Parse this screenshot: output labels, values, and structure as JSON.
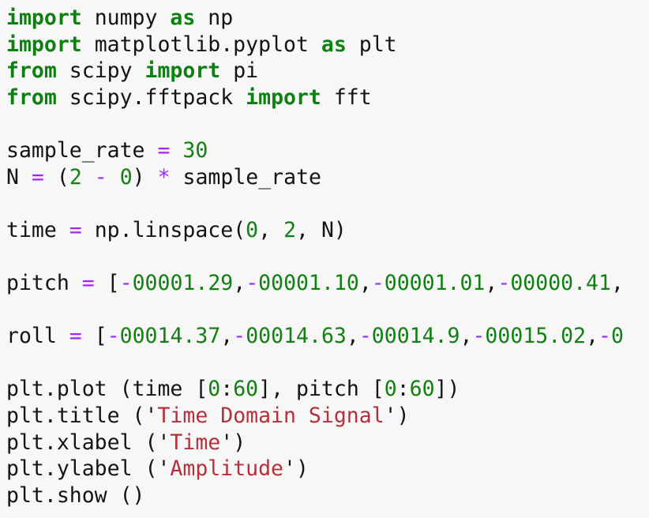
{
  "editor": {
    "background_color": "#f7f7f7",
    "default_text_color": "#141414",
    "language": "python",
    "syntax_colors": {
      "keyword": "#0e8012",
      "number": "#128012",
      "operator": "#aa22ff",
      "string": "#b5303a",
      "punctuation": "#141414",
      "identifier": "#141414"
    }
  },
  "code": {
    "lines": [
      {
        "index": 1,
        "text": "import numpy as np",
        "tokens": [
          {
            "t": "import",
            "k": "kw"
          },
          {
            "t": " numpy ",
            "k": "name"
          },
          {
            "t": "as",
            "k": "kw"
          },
          {
            "t": " np",
            "k": "name"
          }
        ]
      },
      {
        "index": 2,
        "text": "import matplotlib.pyplot as plt",
        "tokens": [
          {
            "t": "import",
            "k": "kw"
          },
          {
            "t": " matplotlib.pyplot ",
            "k": "name"
          },
          {
            "t": "as",
            "k": "kw"
          },
          {
            "t": " plt",
            "k": "name"
          }
        ]
      },
      {
        "index": 3,
        "text": "from scipy import pi",
        "tokens": [
          {
            "t": "from",
            "k": "kw"
          },
          {
            "t": " scipy ",
            "k": "name"
          },
          {
            "t": "import",
            "k": "kw"
          },
          {
            "t": " pi",
            "k": "name"
          }
        ]
      },
      {
        "index": 4,
        "text": "from scipy.fftpack import fft",
        "tokens": [
          {
            "t": "from",
            "k": "kw"
          },
          {
            "t": " scipy.fftpack ",
            "k": "name"
          },
          {
            "t": "import",
            "k": "kw"
          },
          {
            "t": " fft",
            "k": "name"
          }
        ]
      },
      {
        "index": 5,
        "text": "",
        "tokens": []
      },
      {
        "index": 6,
        "text": "sample_rate = 30",
        "tokens": [
          {
            "t": "sample_rate ",
            "k": "name"
          },
          {
            "t": "=",
            "k": "op"
          },
          {
            "t": " ",
            "k": "name"
          },
          {
            "t": "30",
            "k": "num"
          }
        ]
      },
      {
        "index": 7,
        "text": "N = (2 - 0) * sample_rate",
        "tokens": [
          {
            "t": "N ",
            "k": "name"
          },
          {
            "t": "=",
            "k": "op"
          },
          {
            "t": " (",
            "k": "punct"
          },
          {
            "t": "2",
            "k": "num"
          },
          {
            "t": " ",
            "k": "name"
          },
          {
            "t": "-",
            "k": "op"
          },
          {
            "t": " ",
            "k": "name"
          },
          {
            "t": "0",
            "k": "num"
          },
          {
            "t": ") ",
            "k": "punct"
          },
          {
            "t": "*",
            "k": "op"
          },
          {
            "t": " sample_rate",
            "k": "name"
          }
        ]
      },
      {
        "index": 8,
        "text": "",
        "tokens": []
      },
      {
        "index": 9,
        "text": "time = np.linspace(0, 2, N)",
        "tokens": [
          {
            "t": "time ",
            "k": "name"
          },
          {
            "t": "=",
            "k": "op"
          },
          {
            "t": " np.linspace(",
            "k": "name"
          },
          {
            "t": "0",
            "k": "num"
          },
          {
            "t": ", ",
            "k": "punct"
          },
          {
            "t": "2",
            "k": "num"
          },
          {
            "t": ", N)",
            "k": "name"
          }
        ]
      },
      {
        "index": 10,
        "text": "",
        "tokens": []
      },
      {
        "index": 11,
        "text": "pitch = [-00001.29,-00001.10,-00001.01,-00000.41,",
        "tokens": [
          {
            "t": "pitch ",
            "k": "name"
          },
          {
            "t": "=",
            "k": "op"
          },
          {
            "t": " [",
            "k": "punct"
          },
          {
            "t": "-",
            "k": "op"
          },
          {
            "t": "00001.29",
            "k": "num"
          },
          {
            "t": ",",
            "k": "punct"
          },
          {
            "t": "-",
            "k": "op"
          },
          {
            "t": "00001.10",
            "k": "num"
          },
          {
            "t": ",",
            "k": "punct"
          },
          {
            "t": "-",
            "k": "op"
          },
          {
            "t": "00001.01",
            "k": "num"
          },
          {
            "t": ",",
            "k": "punct"
          },
          {
            "t": "-",
            "k": "op"
          },
          {
            "t": "00000.41",
            "k": "num"
          },
          {
            "t": ",",
            "k": "punct"
          }
        ]
      },
      {
        "index": 12,
        "text": "",
        "tokens": []
      },
      {
        "index": 13,
        "text": "roll = [-00014.37,-00014.63,-00014.9,-00015.02,-0",
        "tokens": [
          {
            "t": "roll ",
            "k": "name"
          },
          {
            "t": "=",
            "k": "op"
          },
          {
            "t": " [",
            "k": "punct"
          },
          {
            "t": "-",
            "k": "op"
          },
          {
            "t": "00014.37",
            "k": "num"
          },
          {
            "t": ",",
            "k": "punct"
          },
          {
            "t": "-",
            "k": "op"
          },
          {
            "t": "00014.63",
            "k": "num"
          },
          {
            "t": ",",
            "k": "punct"
          },
          {
            "t": "-",
            "k": "op"
          },
          {
            "t": "00014.9",
            "k": "num"
          },
          {
            "t": ",",
            "k": "punct"
          },
          {
            "t": "-",
            "k": "op"
          },
          {
            "t": "00015.02",
            "k": "num"
          },
          {
            "t": ",",
            "k": "punct"
          },
          {
            "t": "-",
            "k": "op"
          },
          {
            "t": "0",
            "k": "num"
          }
        ]
      },
      {
        "index": 14,
        "text": "",
        "tokens": []
      },
      {
        "index": 15,
        "text": "plt.plot (time [0:60], pitch [0:60])",
        "tokens": [
          {
            "t": "plt.plot (time [",
            "k": "name"
          },
          {
            "t": "0",
            "k": "num"
          },
          {
            "t": ":",
            "k": "punct"
          },
          {
            "t": "60",
            "k": "num"
          },
          {
            "t": "], pitch [",
            "k": "name"
          },
          {
            "t": "0",
            "k": "num"
          },
          {
            "t": ":",
            "k": "punct"
          },
          {
            "t": "60",
            "k": "num"
          },
          {
            "t": "])",
            "k": "name"
          }
        ]
      },
      {
        "index": 16,
        "text": "plt.title ('Time Domain Signal')",
        "tokens": [
          {
            "t": "plt.title (",
            "k": "name"
          },
          {
            "t": "'",
            "k": "punct"
          },
          {
            "t": "Time Domain Signal",
            "k": "str"
          },
          {
            "t": "'",
            "k": "punct"
          },
          {
            "t": ")",
            "k": "name"
          }
        ]
      },
      {
        "index": 17,
        "text": "plt.xlabel ('Time')",
        "tokens": [
          {
            "t": "plt.xlabel (",
            "k": "name"
          },
          {
            "t": "'",
            "k": "punct"
          },
          {
            "t": "Time",
            "k": "str"
          },
          {
            "t": "'",
            "k": "punct"
          },
          {
            "t": ")",
            "k": "name"
          }
        ]
      },
      {
        "index": 18,
        "text": "plt.ylabel ('Amplitude')",
        "tokens": [
          {
            "t": "plt.ylabel (",
            "k": "name"
          },
          {
            "t": "'",
            "k": "punct"
          },
          {
            "t": "Amplitude",
            "k": "str"
          },
          {
            "t": "'",
            "k": "punct"
          },
          {
            "t": ")",
            "k": "name"
          }
        ]
      },
      {
        "index": 19,
        "text": "plt.show ()",
        "tokens": [
          {
            "t": "plt.show ()",
            "k": "name"
          }
        ]
      }
    ]
  }
}
